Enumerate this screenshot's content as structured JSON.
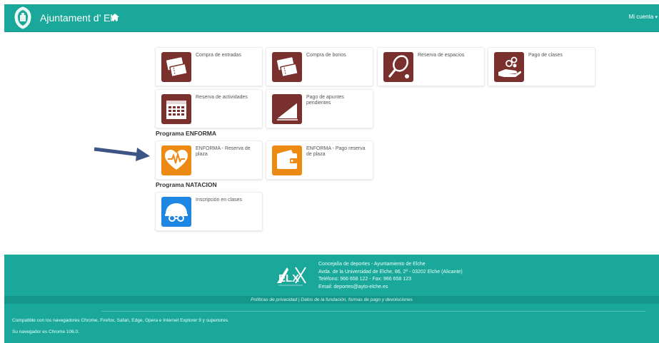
{
  "navbar": {
    "brand": "Ajuntament d’ Elx",
    "account_label": "Mi cuenta",
    "account_caret": "▾",
    "color": "#1aa89a"
  },
  "tiles": [
    {
      "label": "Compra de entradas",
      "icon": "tickets-icon",
      "color": "#7a302d"
    },
    {
      "label": "Compra de bonos",
      "icon": "tickets-icon",
      "color": "#7a302d"
    },
    {
      "label": "Reserva de espacios",
      "icon": "tennis-racket-icon",
      "color": "#7a302d"
    },
    {
      "label": "Pago de clases",
      "icon": "hand-coins-icon",
      "color": "#7a302d"
    },
    {
      "label": "Reserva de actividades",
      "icon": "calendar-icon",
      "color": "#7a302d"
    },
    {
      "label": "Pago de apuntes pendientes",
      "icon": "chart-ramp-icon",
      "color": "#7a302d"
    }
  ],
  "sections": [
    {
      "title": "Programa ENFORMA",
      "tiles": [
        {
          "label": "ENFORMA - Reserva de plaza",
          "icon": "heart-pulse-icon",
          "color": "#ec8a14"
        },
        {
          "label": "ENFORMA - Pago reserva de plaza",
          "icon": "wallet-icon",
          "color": "#ec8a14"
        }
      ]
    },
    {
      "title": "Programa NATACION",
      "tiles": [
        {
          "label": "Inscripción en clases",
          "icon": "swim-cap-icon",
          "color": "#1e86e3"
        }
      ]
    }
  ],
  "footer": {
    "info": [
      "Concejalía de deportes - Ayuntamiento de Elche",
      "Avda. de la Universidad de Elche, 86, 2º - 03202 Elche (Alicante)",
      "Teléfono: 966 658 122 - Fax: 966 658 123",
      "Email: deportes@ayto-elche.es"
    ],
    "links": "Políticas de privacidad  |  Datos de la fundación, formas de pago y devoluciones",
    "compat": "Compatible con los navegadores Chrome, Firefox, Safari, Edge, Opera e Internet Explorer 9 y superiores.",
    "browser": "Su navegador es Chrome 106.0."
  }
}
